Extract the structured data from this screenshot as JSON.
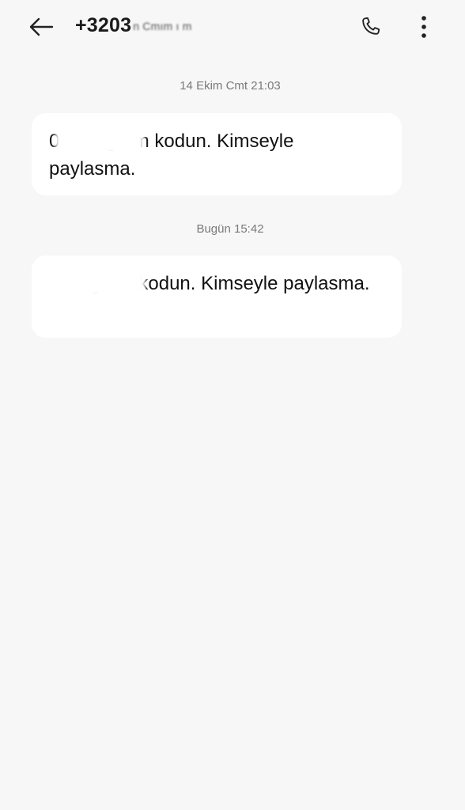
{
  "header": {
    "title": "+3203",
    "title_obscured": "n Cmım ı m",
    "back_icon": "arrow-left-icon",
    "call_icon": "phone-icon",
    "menu_icon": "more-vertical-icon"
  },
  "messages": [
    {
      "timestamp": "14 Ekim Cmt 21:03",
      "text": "0 Instagram kodun. Kimseyle paylasma."
    },
    {
      "timestamp": "Bugün 15:42",
      "text": "Instagram kodun. Kimseyle paylasma."
    }
  ],
  "colors": {
    "background": "#f7f7f7",
    "bubble": "#ffffff",
    "text": "#111111",
    "timestamp": "#7a7a7a"
  }
}
